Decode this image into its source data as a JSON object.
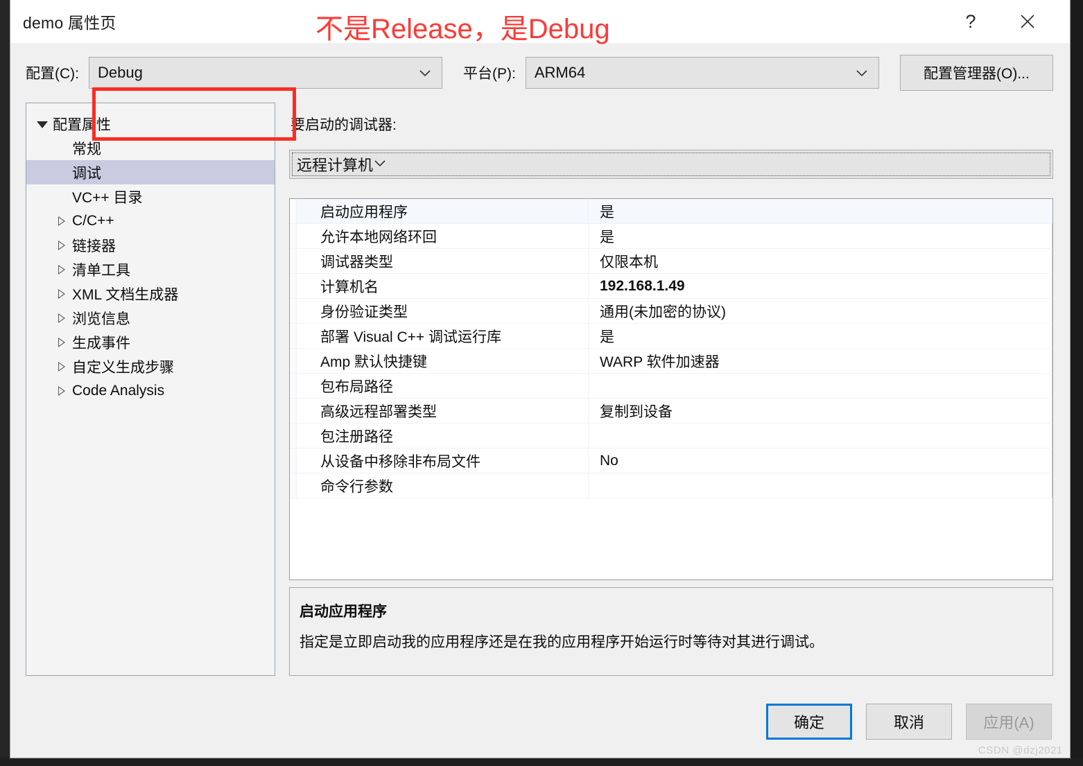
{
  "window": {
    "title": "demo 属性页",
    "help_icon": "question-mark-icon",
    "close_icon": "close-icon"
  },
  "annotation": {
    "text": "不是Release，是Debug",
    "color": "#fc3a35",
    "box_color": "#fb2c22"
  },
  "config_bar": {
    "configuration_label": "配置(C):",
    "configuration_value": "Debug",
    "platform_label": "平台(P):",
    "platform_value": "ARM64",
    "config_manager_label": "配置管理器(O)..."
  },
  "tree": {
    "items": [
      {
        "label": "配置属性",
        "level": 0,
        "twisty": "down",
        "selected": false
      },
      {
        "label": "常规",
        "level": 1,
        "twisty": "none",
        "selected": false
      },
      {
        "label": "调试",
        "level": 1,
        "twisty": "none",
        "selected": true
      },
      {
        "label": "VC++ 目录",
        "level": 1,
        "twisty": "none",
        "selected": false
      },
      {
        "label": "C/C++",
        "level": 1,
        "twisty": "right",
        "selected": false
      },
      {
        "label": "链接器",
        "level": 1,
        "twisty": "right",
        "selected": false
      },
      {
        "label": "清单工具",
        "level": 1,
        "twisty": "right",
        "selected": false
      },
      {
        "label": "XML 文档生成器",
        "level": 1,
        "twisty": "right",
        "selected": false
      },
      {
        "label": "浏览信息",
        "level": 1,
        "twisty": "right",
        "selected": false
      },
      {
        "label": "生成事件",
        "level": 1,
        "twisty": "right",
        "selected": false
      },
      {
        "label": "自定义生成步骤",
        "level": 1,
        "twisty": "right",
        "selected": false
      },
      {
        "label": "Code Analysis",
        "level": 1,
        "twisty": "right",
        "selected": false
      }
    ]
  },
  "debugger": {
    "label": "要启动的调试器:",
    "value": "远程计算机"
  },
  "properties": [
    {
      "name": "启动应用程序",
      "value": "是",
      "bold": false,
      "highlight": true
    },
    {
      "name": "允许本地网络环回",
      "value": "是",
      "bold": false,
      "highlight": false
    },
    {
      "name": "调试器类型",
      "value": "仅限本机",
      "bold": false,
      "highlight": false
    },
    {
      "name": "计算机名",
      "value": "192.168.1.49",
      "bold": true,
      "highlight": false
    },
    {
      "name": "身份验证类型",
      "value": "通用(未加密的协议)",
      "bold": false,
      "highlight": false
    },
    {
      "name": "部署 Visual C++ 调试运行库",
      "value": "是",
      "bold": false,
      "highlight": false
    },
    {
      "name": "Amp 默认快捷键",
      "value": "WARP 软件加速器",
      "bold": false,
      "highlight": false
    },
    {
      "name": "包布局路径",
      "value": "",
      "bold": false,
      "highlight": false
    },
    {
      "name": "高级远程部署类型",
      "value": "复制到设备",
      "bold": false,
      "highlight": false
    },
    {
      "name": "包注册路径",
      "value": "",
      "bold": false,
      "highlight": false
    },
    {
      "name": "从设备中移除非布局文件",
      "value": "No",
      "bold": false,
      "highlight": false
    },
    {
      "name": "命令行参数",
      "value": "",
      "bold": false,
      "highlight": false
    }
  ],
  "description": {
    "title": "启动应用程序",
    "text": "指定是立即启动我的应用程序还是在我的应用程序开始运行时等待对其进行调试。"
  },
  "footer": {
    "ok_label": "确定",
    "cancel_label": "取消",
    "apply_label": "应用(A)",
    "watermark": "CSDN @dzj2021"
  }
}
